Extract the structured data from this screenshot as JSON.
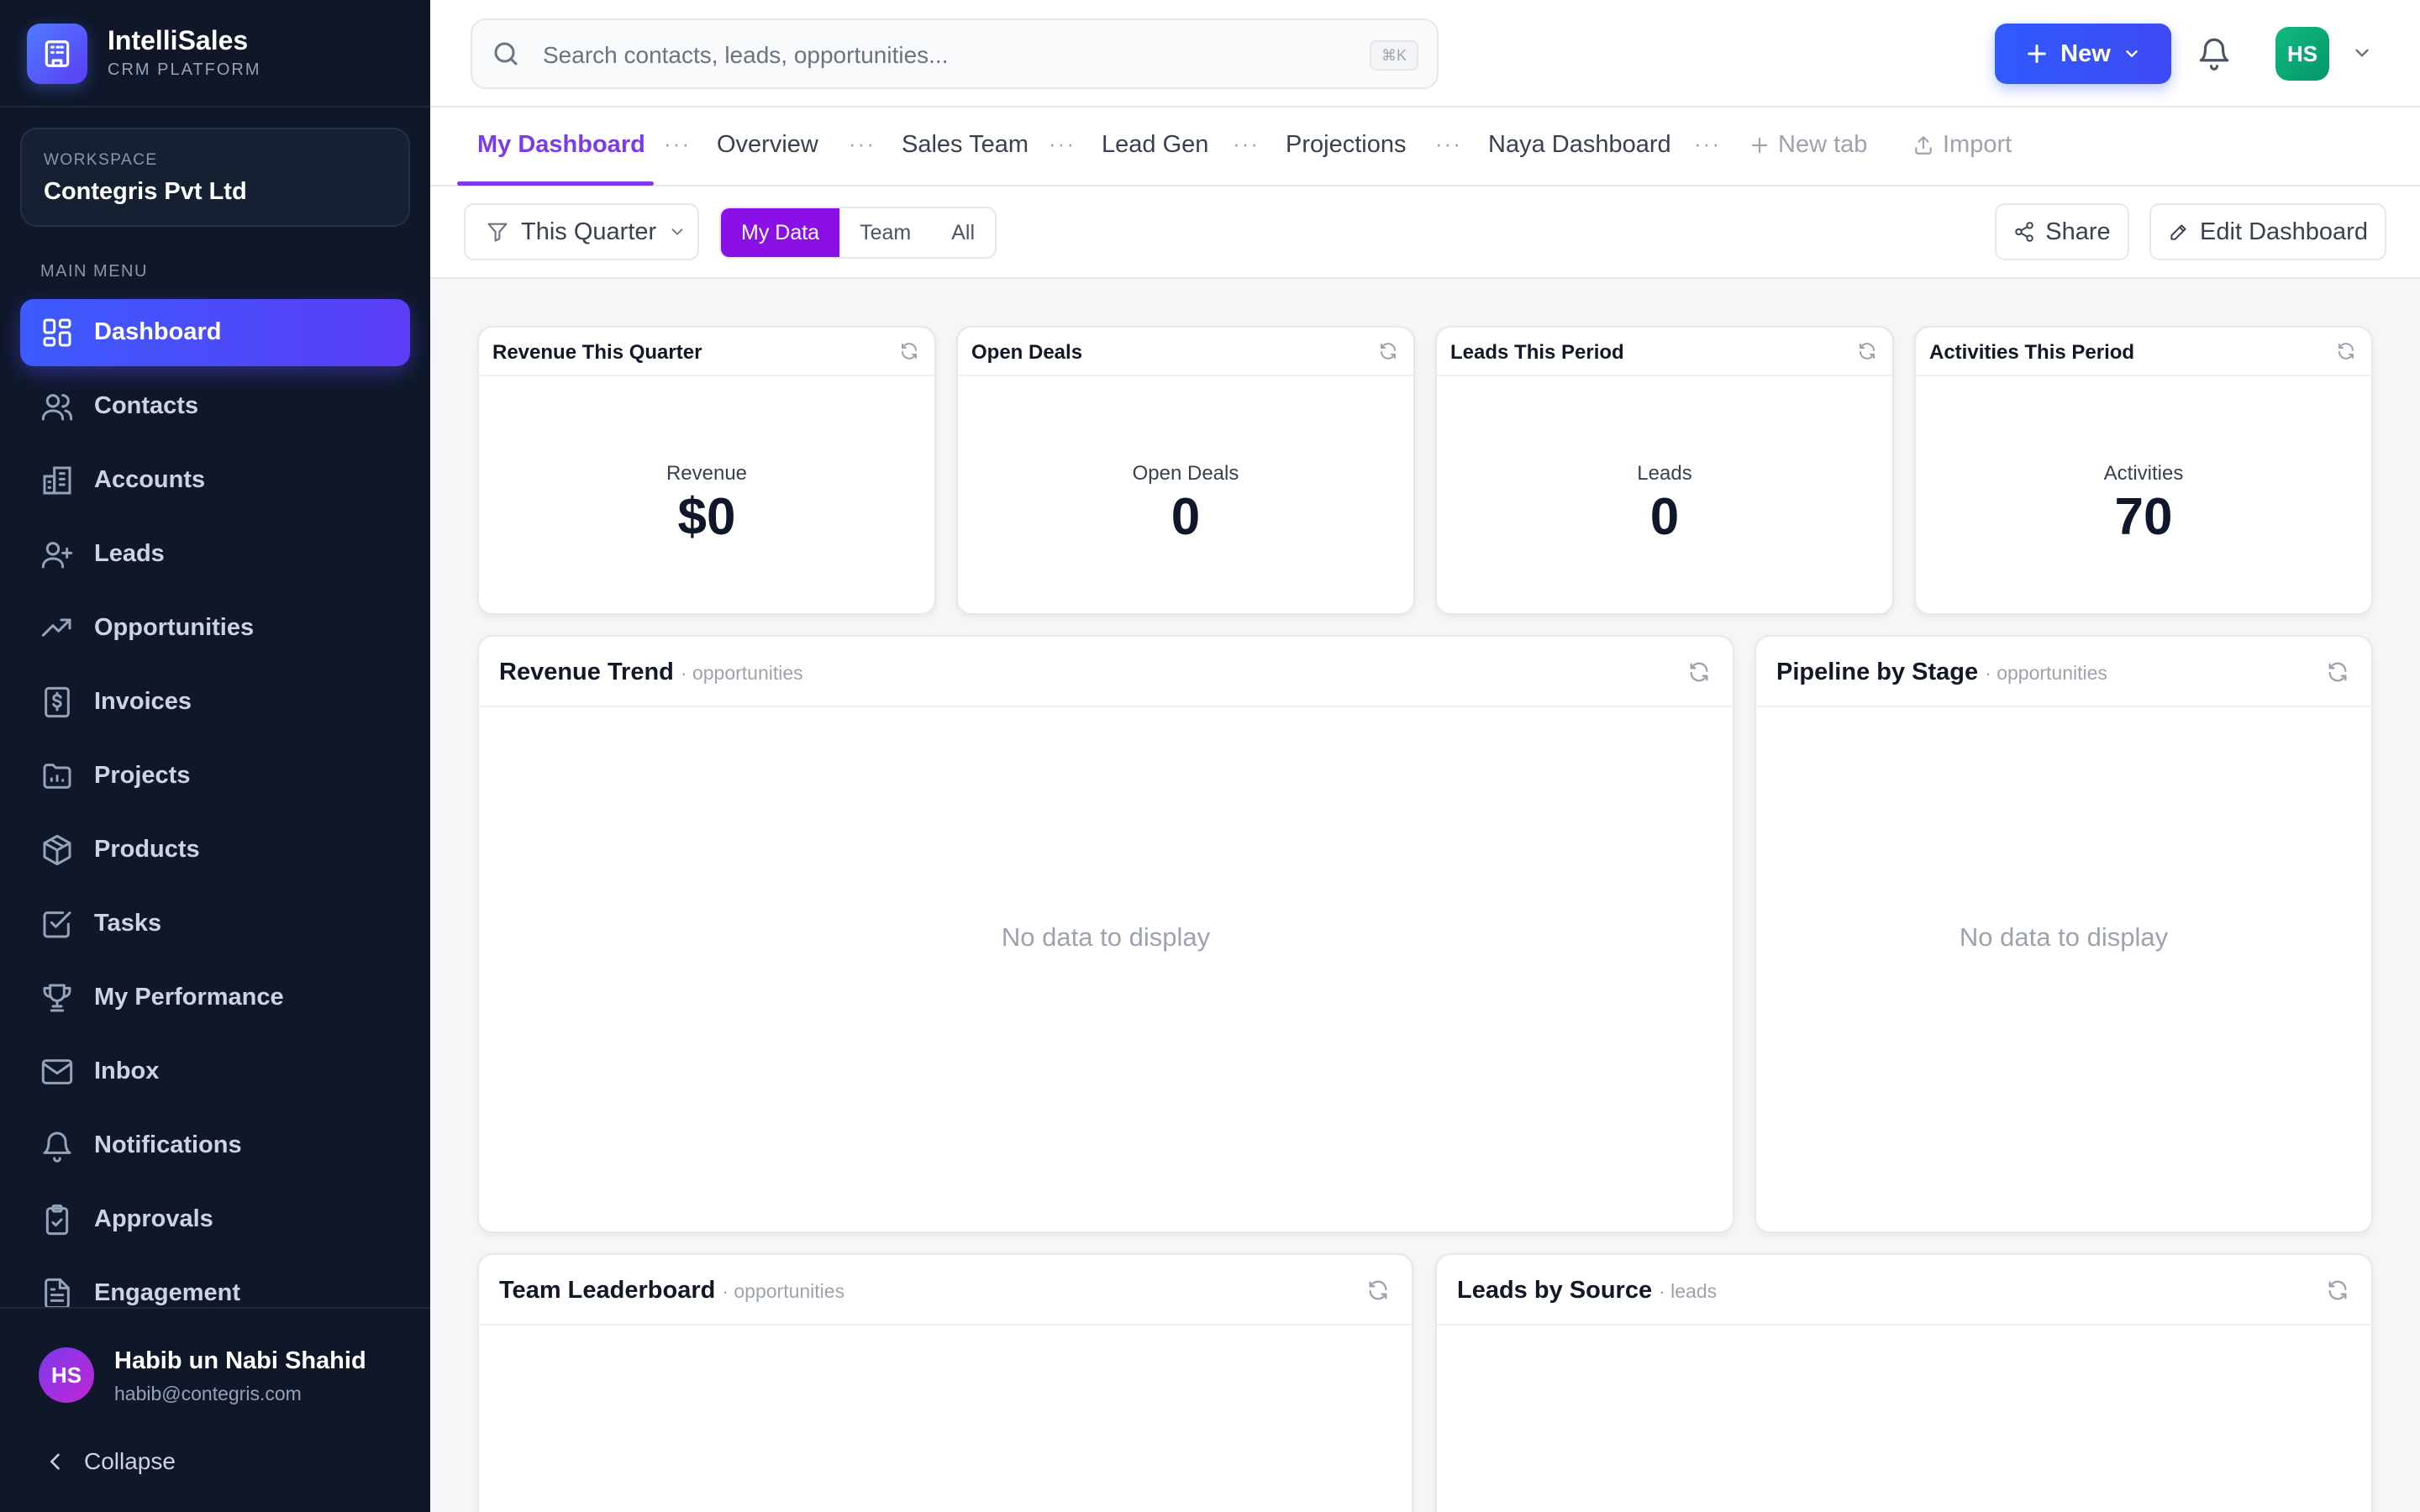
{
  "brand": {
    "name": "IntelliSales",
    "subtitle": "CRM PLATFORM"
  },
  "workspace": {
    "label": "WORKSPACE",
    "name": "Contegris Pvt Ltd"
  },
  "sidebar": {
    "menu_label": "MAIN MENU",
    "items": [
      {
        "label": "Dashboard",
        "icon": "grid-icon",
        "active": true
      },
      {
        "label": "Contacts",
        "icon": "users-icon"
      },
      {
        "label": "Accounts",
        "icon": "building-icon"
      },
      {
        "label": "Leads",
        "icon": "user-plus-icon"
      },
      {
        "label": "Opportunities",
        "icon": "trending-up-icon"
      },
      {
        "label": "Invoices",
        "icon": "invoice-icon"
      },
      {
        "label": "Projects",
        "icon": "folder-icon"
      },
      {
        "label": "Products",
        "icon": "box-icon"
      },
      {
        "label": "Tasks",
        "icon": "checkbox-icon"
      },
      {
        "label": "My Performance",
        "icon": "trophy-icon"
      },
      {
        "label": "Inbox",
        "icon": "mail-icon"
      },
      {
        "label": "Notifications",
        "icon": "bell-icon"
      },
      {
        "label": "Approvals",
        "icon": "clipboard-check-icon"
      },
      {
        "label": "Engagement",
        "icon": "document-icon"
      }
    ],
    "user": {
      "initials": "HS",
      "name": "Habib un Nabi Shahid",
      "email": "habib@contegris.com"
    },
    "collapse_label": "Collapse"
  },
  "topbar": {
    "search_placeholder": "Search contacts, leads, opportunities...",
    "search_shortcut": "⌘K",
    "new_label": "New",
    "avatar_initials": "HS"
  },
  "tabs": {
    "items": [
      "My Dashboard",
      "Overview",
      "Sales Team",
      "Lead Gen",
      "Projections",
      "Naya Dashboard"
    ],
    "active_index": 0,
    "more_glyph": "···",
    "new_tab_label": "New tab",
    "import_label": "Import"
  },
  "filters": {
    "period": "This Quarter",
    "scope_options": [
      "My Data",
      "Team",
      "All"
    ],
    "scope_selected": "My Data",
    "share_label": "Share",
    "edit_label": "Edit Dashboard"
  },
  "kpis": [
    {
      "title": "Revenue This Quarter",
      "label": "Revenue",
      "value": "$0"
    },
    {
      "title": "Open Deals",
      "label": "Open Deals",
      "value": "0"
    },
    {
      "title": "Leads This Period",
      "label": "Leads",
      "value": "0"
    },
    {
      "title": "Activities This Period",
      "label": "Activities",
      "value": "70"
    }
  ],
  "panels": [
    {
      "title": "Revenue Trend",
      "subtitle": "· opportunities",
      "empty_text": "No data to display"
    },
    {
      "title": "Pipeline by Stage",
      "subtitle": "· opportunities",
      "empty_text": "No data to display"
    },
    {
      "title": "Team Leaderboard",
      "subtitle": "· opportunities"
    },
    {
      "title": "Leads by Source",
      "subtitle": "· leads"
    }
  ],
  "colors": {
    "sidebar_bg": "#0f1729",
    "accent_blue": "#2f5bff",
    "accent_purple": "#7c3aed",
    "segment_on": "#8b10e6"
  }
}
